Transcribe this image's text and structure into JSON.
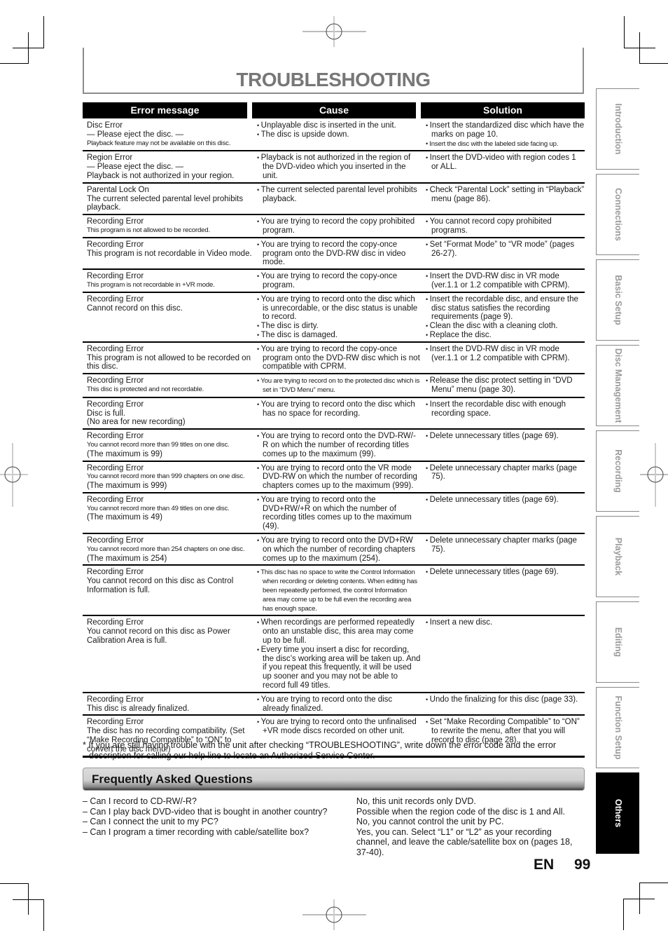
{
  "page": {
    "title": "TROUBLESHOOTING",
    "language": "EN",
    "page_number": "99"
  },
  "table": {
    "headers": [
      "Error message",
      "Cause",
      "Solution"
    ],
    "rows": [
      {
        "error": [
          "Disc Error",
          "— Please eject the disc. —"
        ],
        "error_small": [
          "Playback feature may not be available on this disc."
        ],
        "cause": [
          "Unplayable disc is inserted in the unit.",
          "The disc is upside down."
        ],
        "solution": [
          "Insert the standardized disc which have the marks on page 10."
        ],
        "solution_small": [
          "Insert the disc with the labeled side facing up."
        ]
      },
      {
        "error": [
          "Region Error",
          "— Please eject the disc. —",
          "Playback is not authorized in your region."
        ],
        "cause": [
          "Playback is not authorized in the region of the DVD-video which you inserted in the unit."
        ],
        "solution": [
          "Insert the DVD-video with region codes 1 or ALL."
        ]
      },
      {
        "error": [
          "Parental Lock On",
          "The current selected parental level prohibits playback."
        ],
        "cause": [
          "The current selected parental level prohibits playback."
        ],
        "solution": [
          "Check “Parental Lock” setting in “Playback” menu (page 86)."
        ]
      },
      {
        "error": [
          "Recording Error"
        ],
        "error_small": [
          "This program is not allowed to be recorded."
        ],
        "cause": [
          "You are trying to record the copy prohibited program."
        ],
        "solution": [
          "You cannot record copy prohibited programs."
        ]
      },
      {
        "error": [
          "Recording Error",
          "This program is not recordable in Video mode."
        ],
        "cause": [
          "You are trying to record the copy-once program onto the DVD-RW disc in video mode."
        ],
        "solution": [
          "Set “Format Mode” to “VR mode” (pages 26-27)."
        ]
      },
      {
        "error": [
          "Recording Error"
        ],
        "error_small": [
          "This program is not recordable in +VR mode."
        ],
        "cause": [
          "You are trying to record the copy-once program."
        ],
        "solution": [
          "Insert the DVD-RW disc in VR mode (ver.1.1 or 1.2 compatible with CPRM)."
        ]
      },
      {
        "error": [
          "Recording Error",
          "Cannot record on this disc."
        ],
        "cause": [
          "You are trying to record onto the disc which is unrecordable, or the disc status is unable to record.",
          "The disc is dirty.",
          "The disc is damaged."
        ],
        "solution": [
          "Insert the recordable disc, and ensure the disc status satisfies the recording requirements (page 9).",
          "Clean the disc with a cleaning cloth.",
          "Replace the disc."
        ]
      },
      {
        "error": [
          "Recording Error",
          "This program is not allowed to be recorded on this disc."
        ],
        "cause": [
          "You are trying to record the copy-once program onto the DVD-RW disc which is not compatible with CPRM."
        ],
        "solution": [
          "Insert the DVD-RW disc in VR mode (ver.1.1 or 1.2 compatible with CPRM)."
        ]
      },
      {
        "error": [
          "Recording Error"
        ],
        "error_small": [
          "This disc is protected and not recordable."
        ],
        "cause_small": [
          "You are trying to record on to the protected disc which is set in “DVD Menu” menu."
        ],
        "solution": [
          "Release the disc protect setting in “DVD Menu” menu (page 30)."
        ]
      },
      {
        "error": [
          "Recording Error",
          "Disc is full.",
          "(No area for new recording)"
        ],
        "cause": [
          "You are trying to record onto the disc which has no space for recording."
        ],
        "solution": [
          "Insert the recordable disc with enough recording space."
        ]
      },
      {
        "error": [
          "Recording Error"
        ],
        "error_small": [
          "You cannot record more than 99 titles on one disc."
        ],
        "error_after": [
          "(The maximum is 99)"
        ],
        "cause": [
          "You are trying to record onto the DVD-RW/-R on which the number of recording titles comes up to the maximum (99)."
        ],
        "solution": [
          "Delete unnecessary titles (page 69)."
        ]
      },
      {
        "error": [
          "Recording Error"
        ],
        "error_small": [
          "You cannot record more than 999 chapters on one disc."
        ],
        "error_after": [
          "(The maximum is 999)"
        ],
        "cause": [
          "You are trying to record onto the VR mode DVD-RW on which the number of recording chapters comes up to the maximum (999)."
        ],
        "solution": [
          "Delete unnecessary chapter marks (page 75)."
        ]
      },
      {
        "error": [
          "Recording Error"
        ],
        "error_small": [
          "You cannot record more than 49 titles on one disc."
        ],
        "error_after": [
          "(The maximum is 49)"
        ],
        "cause": [
          "You are trying to record onto the DVD+RW/+R on which the number of recording titles comes up to the maximum (49)."
        ],
        "solution": [
          "Delete unnecessary titles (page 69)."
        ]
      },
      {
        "error": [
          "Recording Error"
        ],
        "error_small": [
          "You cannot record more than 254 chapters on one disc."
        ],
        "error_after": [
          "(The maximum is 254)"
        ],
        "cause": [
          "You are trying to record onto the DVD+RW on which the number of recording chapters comes up to the maximum (254)."
        ],
        "solution": [
          "Delete unnecessary chapter marks (page 75)."
        ]
      },
      {
        "error": [
          "Recording Error",
          "You cannot record on this disc as Control Information is full."
        ],
        "cause_small": [
          "This disc has no space to write the Control Information when recording or deleting contents. When editing has been repeatedly performed, the control Information area may come up to be full even the recording area has enough space."
        ],
        "solution": [
          "Delete unnecessary titles (page 69)."
        ]
      },
      {
        "error": [
          "Recording Error",
          "You cannot record on this disc as Power Calibration Area is full."
        ],
        "cause": [
          "When recordings are performed repeatedly onto an unstable disc, this area may come up to be full.",
          "Every time you insert a disc for recording, the disc’s working area will be taken up. And if you repeat this frequently, it will be used up sooner and you may not be able to record full 49 titles."
        ],
        "solution": [
          "Insert a new disc."
        ]
      },
      {
        "error": [
          "Recording Error",
          "This disc is already finalized."
        ],
        "cause": [
          "You are trying to record onto the disc already finalized."
        ],
        "solution": [
          "Undo the finalizing for this disc (page 33)."
        ]
      },
      {
        "error": [
          "Recording Error",
          "The disc has no recording compatibility. (Set “Make Recording Compatible” to “ON” to convert the disc menu.)"
        ],
        "cause": [
          "You are trying to record onto the unfinalised +VR mode discs recorded on other unit."
        ],
        "solution": [
          "Set “Make Recording Compatible” to “ON” to rewrite the menu, after that you will record to disc (page 28)."
        ]
      }
    ]
  },
  "footnote": "* If you are still having trouble with the unit after checking “TROUBLESHOOTING”, write down the error code and the error description for calling our help line to locate an Authorized Service Center.",
  "faq": {
    "title": "Frequently Asked Questions",
    "items": [
      {
        "q": "– Can I record to CD-RW/-R?",
        "a": "No, this unit records only DVD."
      },
      {
        "q": "– Can I play back DVD-video that is bought in another country?",
        "a": "Possible when the region code of the disc is 1 and All."
      },
      {
        "q": "– Can I connect the unit to my PC?",
        "a": "No, you cannot control the unit by PC."
      },
      {
        "q": "– Can I program a timer recording with cable/satellite box?",
        "a": "Yes, you can. Select “L1” or “L2” as your recording channel, and leave the cable/satellite box on (pages 18, 37-40)."
      }
    ]
  },
  "side_tabs": [
    {
      "label": "Introduction",
      "active": false
    },
    {
      "label": "Connections",
      "active": false
    },
    {
      "label": "Basic Setup",
      "active": false
    },
    {
      "label": "Disc Management",
      "active": false
    },
    {
      "label": "Recording",
      "active": false
    },
    {
      "label": "Playback",
      "active": false
    },
    {
      "label": "Editing",
      "active": false
    },
    {
      "label": "Function Setup",
      "active": false
    },
    {
      "label": "Others",
      "active": true
    }
  ]
}
